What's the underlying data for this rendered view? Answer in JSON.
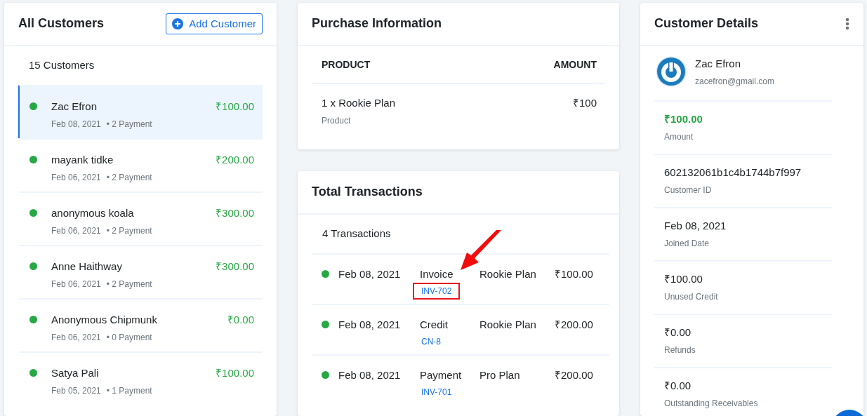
{
  "customers_panel": {
    "title": "All Customers",
    "add_button": "Add Customer",
    "count": "15 Customers",
    "customers": [
      {
        "name": "Zac Efron",
        "date": "Feb 08, 2021",
        "payments": "• 2 Payment",
        "amount": "₹100.00",
        "selected": true
      },
      {
        "name": "mayank tidke",
        "date": "Feb 06, 2021",
        "payments": "• 2 Payment",
        "amount": "₹200.00",
        "selected": false
      },
      {
        "name": "anonymous koala",
        "date": "Feb 06, 2021",
        "payments": "• 2 Payment",
        "amount": "₹300.00",
        "selected": false
      },
      {
        "name": "Anne Haithway",
        "date": "Feb 06, 2021",
        "payments": "• 2 Payment",
        "amount": "₹300.00",
        "selected": false
      },
      {
        "name": "Anonymous Chipmunk",
        "date": "Feb 06, 2021",
        "payments": "• 0 Payment",
        "amount": "₹0.00",
        "selected": false
      },
      {
        "name": "Satya Pali",
        "date": "Feb 05, 2021",
        "payments": "• 1 Payment",
        "amount": "₹100.00",
        "selected": false
      }
    ]
  },
  "purchase_panel": {
    "title": "Purchase Information",
    "columns": [
      "PRODUCT",
      "AMOUNT"
    ],
    "rows": [
      {
        "product": "1 x Rookie Plan",
        "type": "Product",
        "amount": "₹100"
      }
    ]
  },
  "transactions_panel": {
    "title": "Total Transactions",
    "count": "4 Transactions",
    "rows": [
      {
        "date": "Feb 08, 2021",
        "type": "Invoice",
        "reference": "INV-702",
        "plan": "Rookie Plan",
        "amount": "₹100.00",
        "highlighted": true
      },
      {
        "date": "Feb 08, 2021",
        "type": "Credit",
        "reference": "CN-8",
        "plan": "Rookie Plan",
        "amount": "₹200.00",
        "highlighted": false
      },
      {
        "date": "Feb 08, 2021",
        "type": "Payment",
        "reference": "INV-701",
        "plan": "Pro Plan",
        "amount": "₹200.00",
        "highlighted": false
      }
    ]
  },
  "details_panel": {
    "title": "Customer Details",
    "name": "Zac Efron",
    "email": "zacefron@gmail.com",
    "fields": [
      {
        "kind": "amount",
        "value": "₹100.00",
        "label": "Amount"
      },
      {
        "kind": "plain",
        "value": "602132061b1c4b1744b7f997",
        "label": "Customer ID"
      },
      {
        "kind": "plain",
        "value": "Feb 08, 2021",
        "label": "Joined Date"
      },
      {
        "kind": "plain",
        "value": "₹100.00",
        "label": "Unused Credit"
      },
      {
        "kind": "plain",
        "value": "₹0.00",
        "label": "Refunds"
      },
      {
        "kind": "plain",
        "value": "₹0.00",
        "label": "Outstanding Receivables"
      }
    ]
  }
}
